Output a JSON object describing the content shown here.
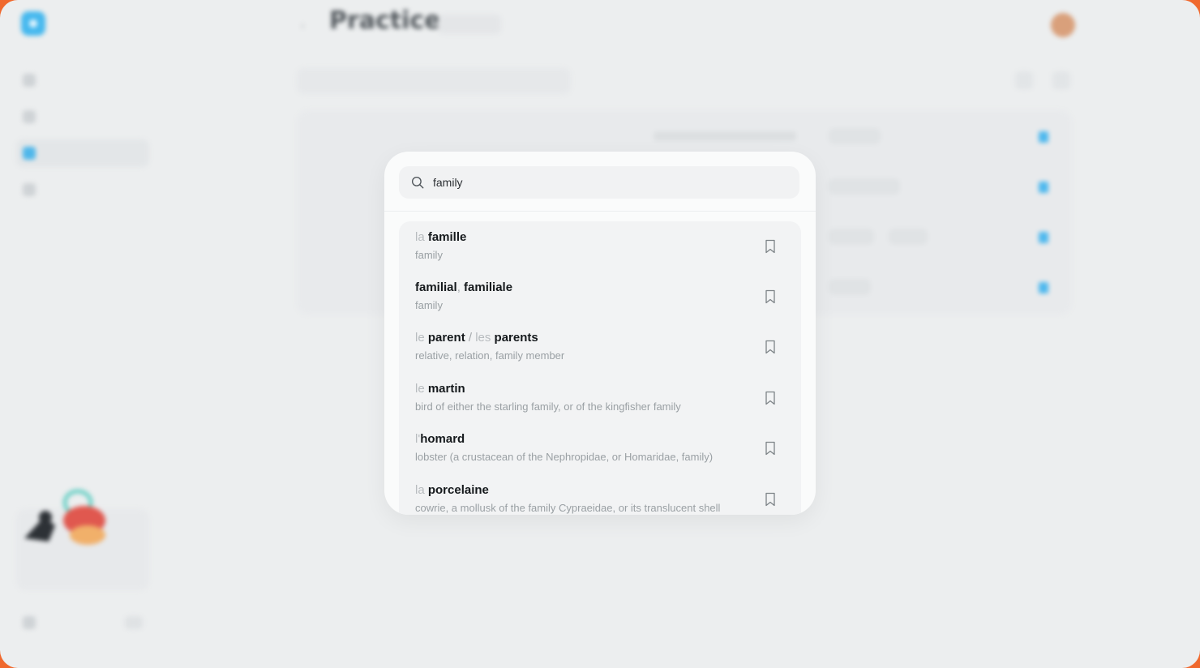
{
  "app": {
    "title": "Practice"
  },
  "search": {
    "value": "family",
    "placeholder": ""
  },
  "results": [
    {
      "article": "la",
      "words": [
        "famille"
      ],
      "separator": "",
      "article2": "",
      "gloss": "family"
    },
    {
      "article": "",
      "words": [
        "familial",
        "familiale"
      ],
      "separator": ",",
      "article2": "",
      "gloss": "family"
    },
    {
      "article": "le",
      "words": [
        "parent",
        "parents"
      ],
      "separator": "/",
      "article2": "les",
      "gloss": "relative, relation, family member"
    },
    {
      "article": "le",
      "words": [
        "martin"
      ],
      "separator": "",
      "article2": "",
      "gloss": "bird of either the starling family, or of the kingfisher family"
    },
    {
      "article": "l'",
      "words": [
        "homard"
      ],
      "separator": "",
      "article2": "",
      "gloss": "lobster (a crustacean of the Nephropidae, or Homaridae, family)"
    },
    {
      "article": "la",
      "words": [
        "porcelaine"
      ],
      "separator": "",
      "article2": "",
      "gloss": "cowrie, a mollusk of the family Cypraeidae, or its translucent shell"
    }
  ],
  "colors": {
    "outer_border": "#f0692e",
    "accent": "#45b8ee"
  },
  "icons": {
    "search": "search-icon",
    "bookmark": "bookmark-icon"
  }
}
